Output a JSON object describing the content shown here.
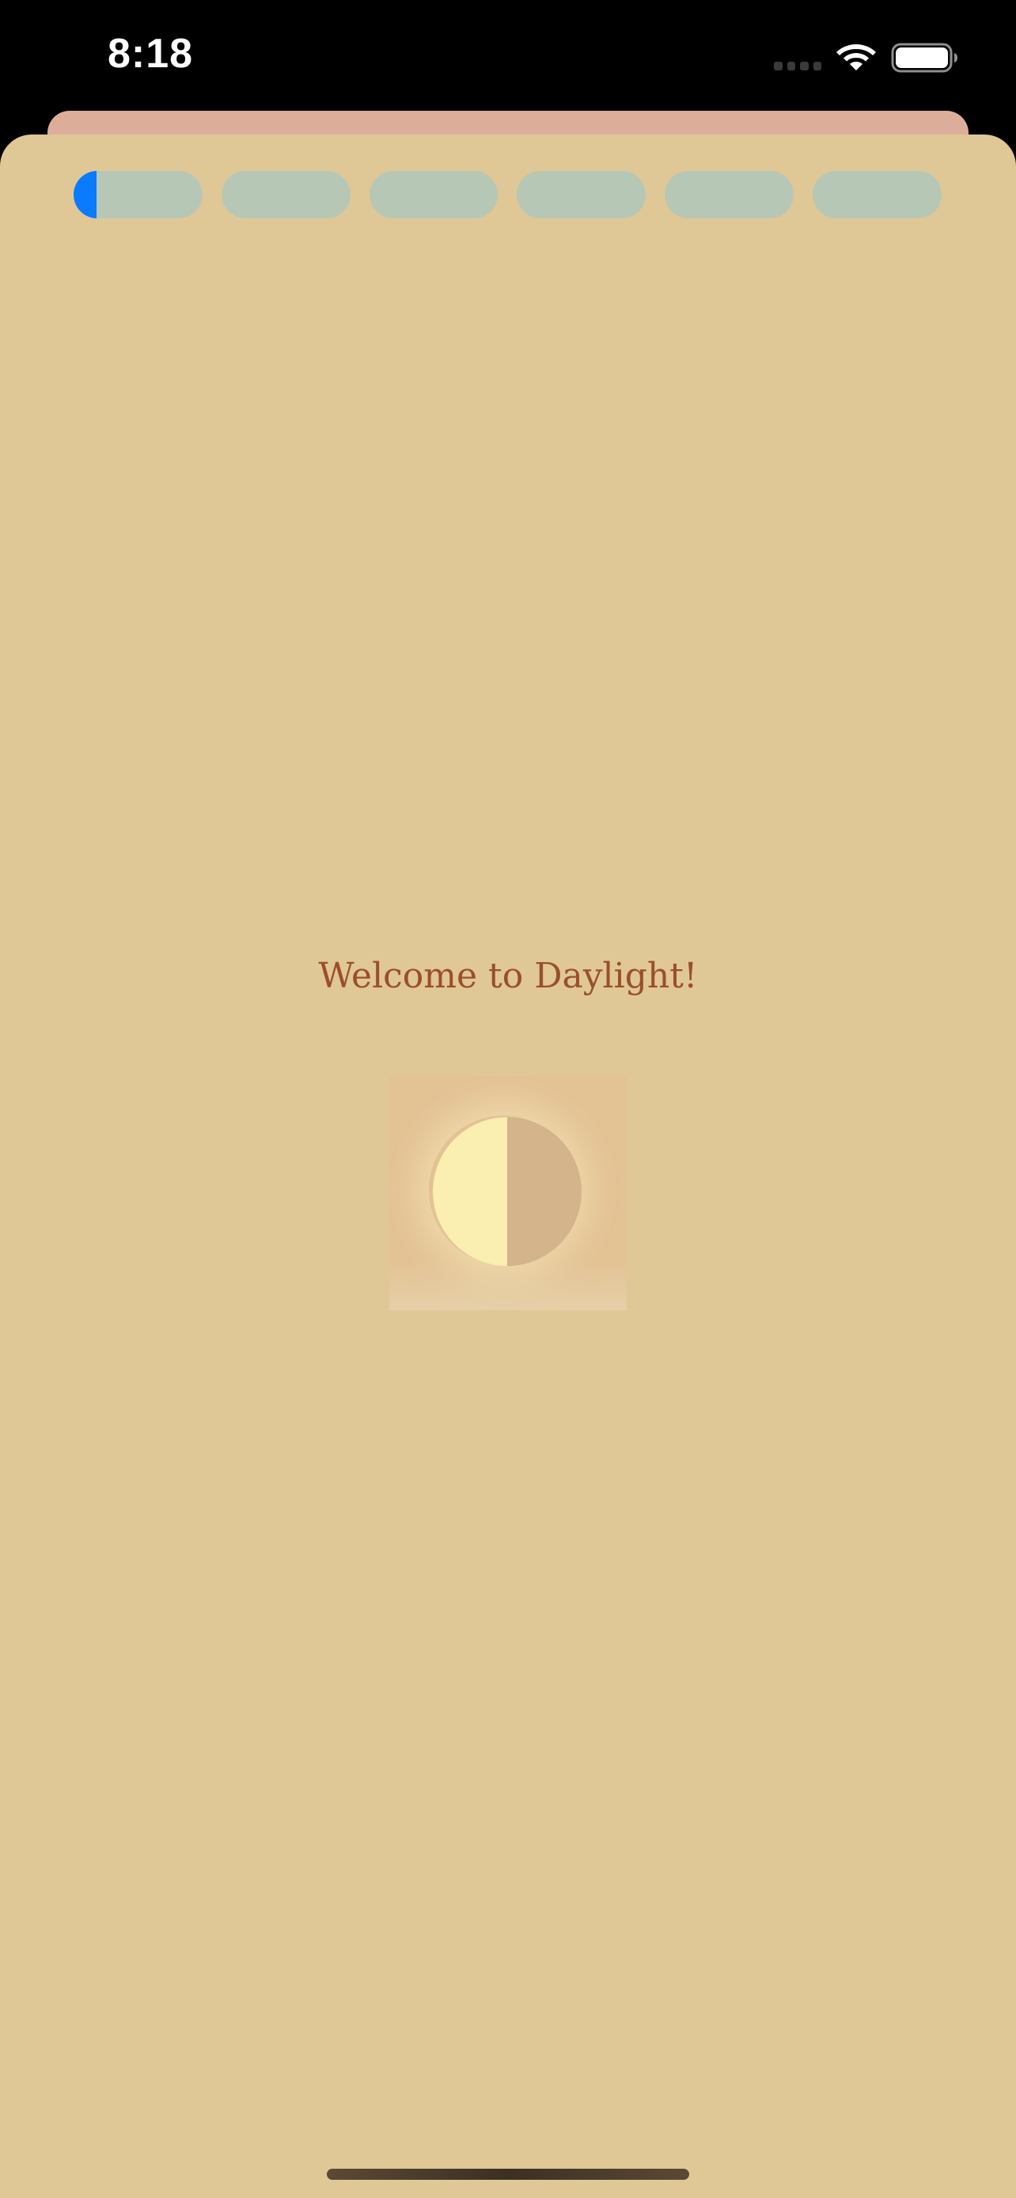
{
  "status_bar": {
    "time": "8:18",
    "icons": [
      "cellular-signal-icon",
      "wifi-icon",
      "battery-icon"
    ]
  },
  "onboarding": {
    "steps_total": 6,
    "current_step": 1,
    "current_step_progress": 0.18,
    "title": "Welcome to Daylight!",
    "logo": "half-sun-moon-icon"
  },
  "colors": {
    "sheet_background": "#e0c796",
    "back_card": "#dcae9a",
    "progress_track": "#b7c7b5",
    "progress_fill": "#0a7aff",
    "title_text": "#9a4f2a",
    "logo_light": "#faeeb0",
    "logo_dark": "#d4b48a"
  }
}
